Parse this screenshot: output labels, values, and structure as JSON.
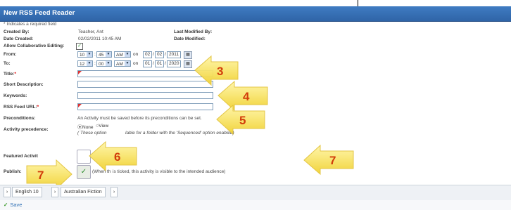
{
  "title": "New RSS Feed Reader",
  "required_note": "* Indicates a required field",
  "created_by": {
    "label": "Created By:",
    "value": "Teacher, Ant"
  },
  "date_created": {
    "label": "Date Created:",
    "value": "02/02/2011 10:45 AM"
  },
  "last_modified_by": {
    "label": "Last Modified By:"
  },
  "date_modified": {
    "label": "Date Modified:"
  },
  "collab": {
    "label": "Allow Collaborative Editing:",
    "checked": true
  },
  "from": {
    "label": "From:",
    "hour": "10",
    "minute": "45",
    "ampm": "AM",
    "on": "on",
    "day": "02",
    "month": "02",
    "year": "2011"
  },
  "to": {
    "label": "To:",
    "hour": "12",
    "minute": "00",
    "ampm": "AM",
    "on": "on",
    "day": "01",
    "month": "01",
    "year": "2020"
  },
  "title_field": {
    "label": "Title:",
    "required": "*"
  },
  "short_desc": {
    "label": "Short Description:"
  },
  "keywords": {
    "label": "Keywords:"
  },
  "rss_url": {
    "label": "RSS Feed URL:",
    "required": "*"
  },
  "preconditions": {
    "label": "Preconditions:",
    "text": "An Activity must be saved before its preconditions can be set."
  },
  "precedence": {
    "label": "Activity precedence:",
    "opt_none": "None",
    "opt_view": "View",
    "note_start": "( These option",
    "note_end": "lable for a folder with the 'Sequenced' option enabled)"
  },
  "featured": {
    "label": "Featured Activit"
  },
  "publish": {
    "label": "Publish:",
    "note_start": "(When th",
    "note_end": "is ticked, this activity is visible to the intended audience)"
  },
  "callouts": [
    "3",
    "4",
    "5",
    "6",
    "7",
    "7"
  ],
  "breadcrumb": [
    "English 10",
    "Australian Fiction"
  ],
  "save_label": "Save",
  "colors": {
    "titlebar": "#3a74b8",
    "callout": "#f8e25a",
    "callout_number": "#d23c0a"
  }
}
